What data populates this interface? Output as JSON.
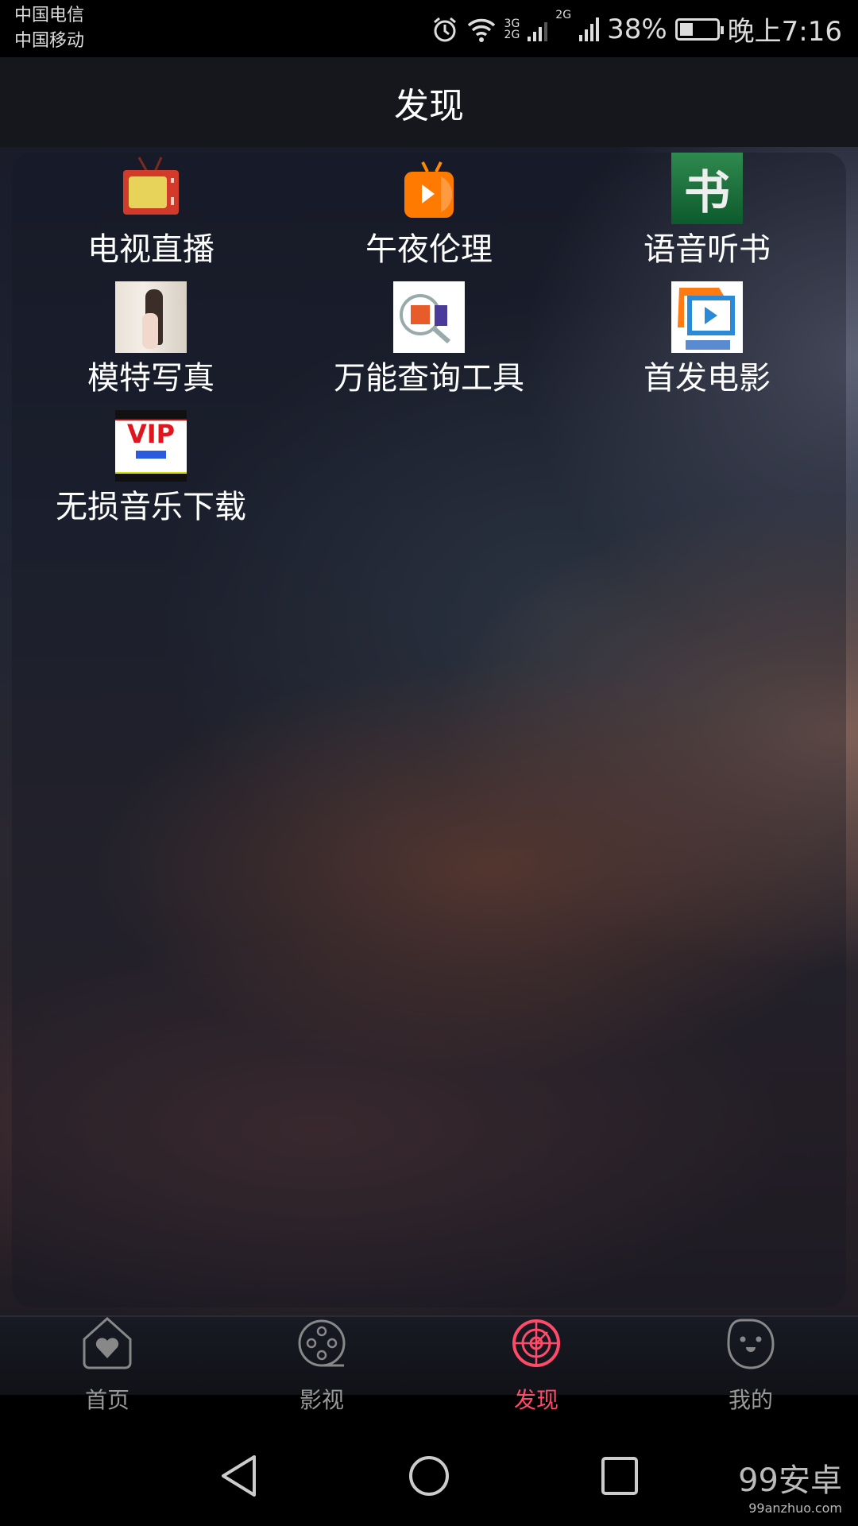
{
  "status_bar": {
    "carrier_1": "中国电信",
    "carrier_2": "中国移动",
    "net_1": "3G",
    "net_2": "2G",
    "net_3": "2G",
    "battery": "38%",
    "battery_level": 0.38,
    "time": "晚上7:16",
    "icons": [
      "alarm-icon",
      "wifi-icon",
      "signal-icon",
      "battery-icon"
    ]
  },
  "header": {
    "title": "发现"
  },
  "apps": [
    {
      "label": "电视直播",
      "icon": "tv-icon"
    },
    {
      "label": "午夜伦理",
      "icon": "orange-tv-play-icon"
    },
    {
      "label": "语音听书",
      "icon": "book-icon"
    },
    {
      "label": "模特写真",
      "icon": "photo-thumbnail"
    },
    {
      "label": "万能查询工具",
      "icon": "query-icon"
    },
    {
      "label": "首发电影",
      "icon": "movie-play-icon"
    },
    {
      "label": "无损音乐下载",
      "icon": "vip-music-icon"
    }
  ],
  "bottom_nav": {
    "active_color": "#ff4a6a",
    "items": [
      {
        "label": "首页",
        "icon": "home-heart-icon"
      },
      {
        "label": "影视",
        "icon": "film-reel-icon"
      },
      {
        "label": "发现",
        "icon": "radar-icon",
        "active": true
      },
      {
        "label": "我的",
        "icon": "face-icon"
      }
    ]
  },
  "watermark": {
    "text": "99安卓",
    "url_text": "99anzhuo.com"
  }
}
